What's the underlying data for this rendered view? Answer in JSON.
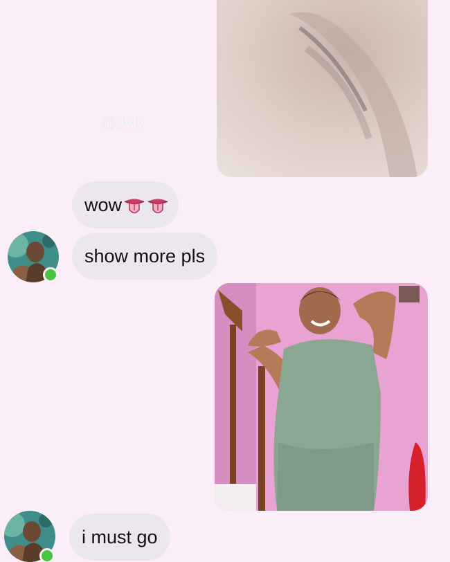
{
  "watermark": "@JvD",
  "messages": [
    {
      "text": "wow",
      "emoji": [
        "tongue-out-mouth-icon",
        "tongue-out-mouth-icon"
      ]
    },
    {
      "text": "show more pls"
    },
    {
      "text": "i must go"
    }
  ],
  "colors": {
    "background": "#fbeef8",
    "bubble": "#ece6ee",
    "online": "#46c540"
  }
}
